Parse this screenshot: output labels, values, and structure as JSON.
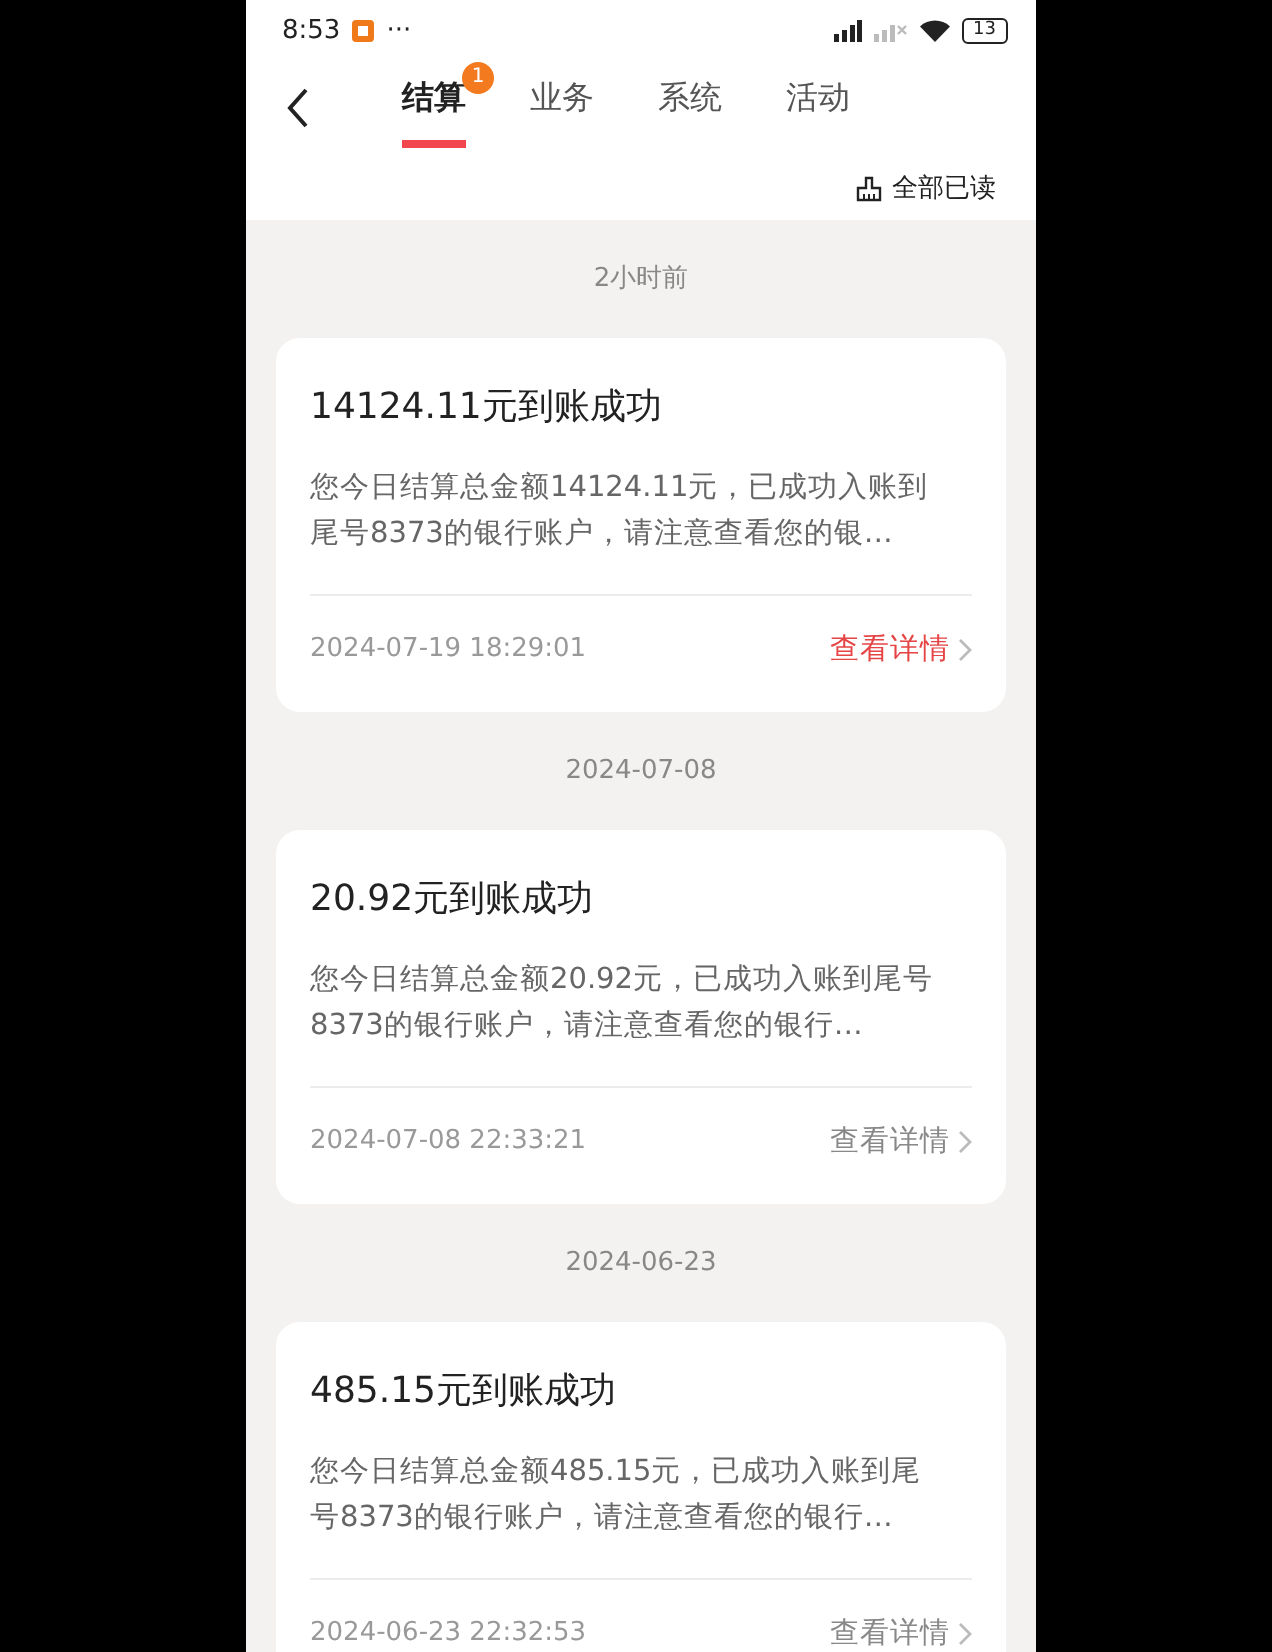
{
  "status_bar": {
    "time": "8:53",
    "more": "···",
    "battery": "13"
  },
  "tabs": [
    {
      "label": "结算",
      "selected": true,
      "badge": "1"
    },
    {
      "label": "业务",
      "selected": false
    },
    {
      "label": "系统",
      "selected": false
    },
    {
      "label": "活动",
      "selected": false
    }
  ],
  "mark_all_read": "全部已读",
  "groups": [
    {
      "date": "2小时前",
      "card": {
        "title": "14124.11元到账成功",
        "body": "您今日结算总金额14124.11元，已成功入账到尾号8373的银行账户，请注意查看您的银…",
        "time": "2024-07-19 18:29:01",
        "link": "查看详情",
        "unread": true
      }
    },
    {
      "date": "2024-07-08",
      "card": {
        "title": "20.92元到账成功",
        "body": "您今日结算总金额20.92元，已成功入账到尾号8373的银行账户，请注意查看您的银行…",
        "time": "2024-07-08 22:33:21",
        "link": "查看详情",
        "unread": false
      }
    },
    {
      "date": "2024-06-23",
      "card": {
        "title": "485.15元到账成功",
        "body": "您今日结算总金额485.15元，已成功入账到尾号8373的银行账户，请注意查看您的银行…",
        "time": "2024-06-23 22:32:53",
        "link": "查看详情",
        "unread": false
      }
    }
  ]
}
